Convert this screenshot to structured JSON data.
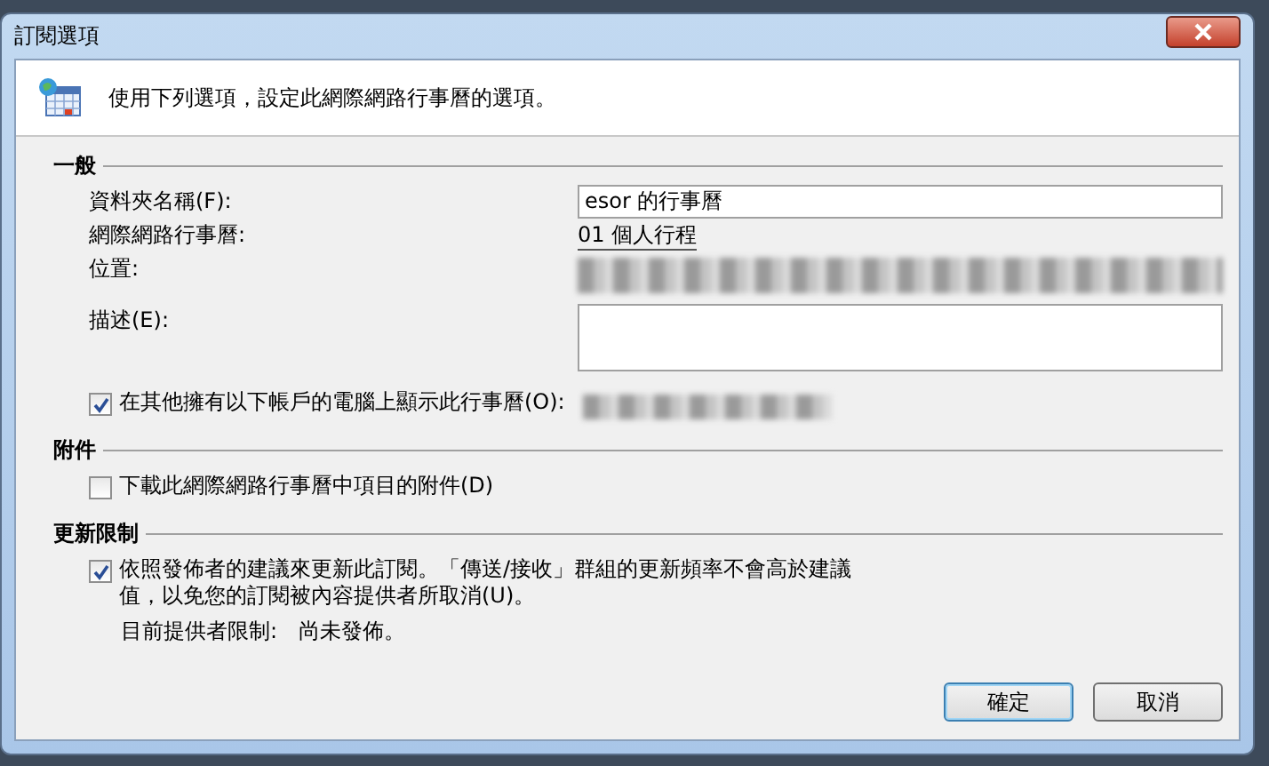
{
  "window": {
    "title": "訂閱選項"
  },
  "header": {
    "text": "使用下列選項，設定此網際網路行事曆的選項。"
  },
  "sections": [
    {
      "title": "一般",
      "rows": [
        {
          "kind": "input",
          "label": "資料夾名稱(F):",
          "value": "esor 的行事曆"
        },
        {
          "kind": "text",
          "label": "網際網路行事曆:",
          "value": "01 個人行程"
        },
        {
          "kind": "hidden",
          "label": "位置:"
        },
        {
          "kind": "textarea",
          "label": "描述(E):"
        },
        {
          "kind": "checkbox",
          "label": "在其他擁有以下帳戶的電腦上顯示此行事曆(O):",
          "checked": true,
          "account_hidden": true
        }
      ]
    },
    {
      "title": "附件",
      "rows": [
        {
          "kind": "checkbox",
          "label": "下載此網際網路行事曆中項目的附件(D)",
          "checked": false
        }
      ]
    },
    {
      "title": "更新限制",
      "rows": [
        {
          "kind": "checkbox",
          "label": "依照發佈者的建議來更新此訂閱。「傳送/接收」群組的更新頻率不會高於建議值，以免您的訂閱被內容提供者所取消(U)。",
          "checked": true
        },
        {
          "kind": "note",
          "label": "目前提供者限制:",
          "value": "尚未發佈。"
        }
      ]
    }
  ],
  "buttons": [
    {
      "label": "確定",
      "default": true
    },
    {
      "label": "取消",
      "default": false
    }
  ]
}
